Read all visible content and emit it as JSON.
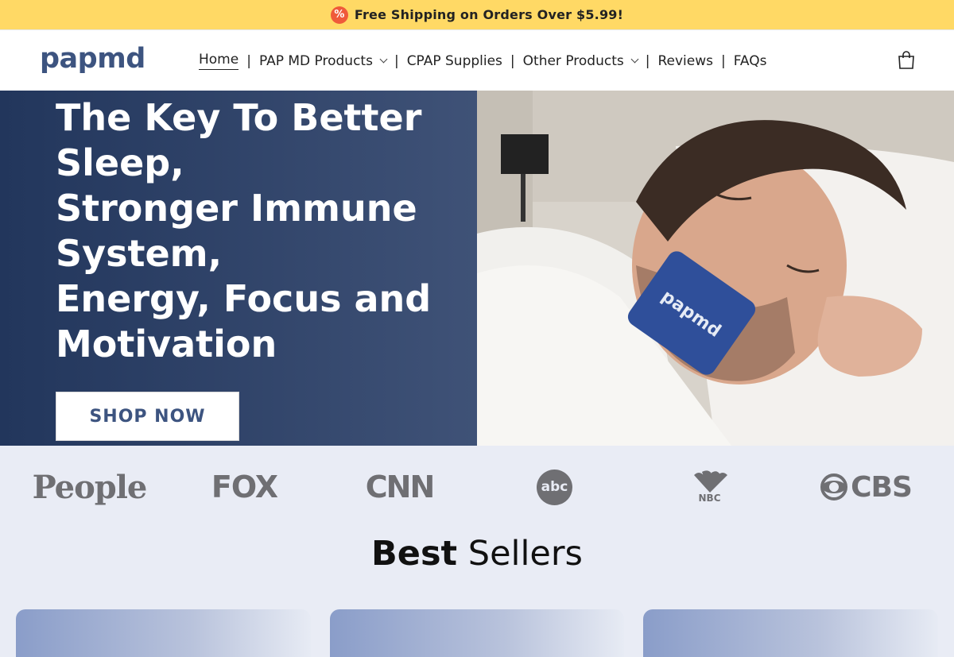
{
  "announcement": {
    "icon": "percent-badge-icon",
    "badge": "%",
    "text": "Free Shipping on Orders Over $5.99!"
  },
  "header": {
    "logo": "papmd",
    "nav": [
      {
        "label": "Home",
        "active": true,
        "dropdown": false
      },
      {
        "label": "PAP MD Products",
        "active": false,
        "dropdown": true
      },
      {
        "label": "CPAP Supplies",
        "active": false,
        "dropdown": false
      },
      {
        "label": "Other Products",
        "active": false,
        "dropdown": true
      },
      {
        "label": "Reviews",
        "active": false,
        "dropdown": false
      },
      {
        "label": "FAQs",
        "active": false,
        "dropdown": false
      }
    ],
    "separator": "|",
    "cart_icon": "shopping-bag-icon"
  },
  "hero": {
    "title_lines": [
      "The Key To Better Sleep,",
      "Stronger Immune System,",
      "energy, Focus and Motivation"
    ],
    "title_display": [
      "The Key To Better",
      "Sleep,",
      "Stronger Immune",
      "System,",
      "Energy, Focus and",
      "Motivation"
    ],
    "cta": "SHOP NOW",
    "image_label": "papmd",
    "colors": {
      "panel_start": "#22365c",
      "panel_end": "#3f5277"
    }
  },
  "press": [
    "People",
    "FOX",
    "CNN",
    "abc",
    "NBC",
    "CBS"
  ],
  "best_sellers": {
    "bold": "Best",
    "light": "Sellers"
  },
  "colors": {
    "brand": "#3d5480",
    "announce_bg": "#ffd965",
    "badge": "#ef5a3a",
    "page_bg": "#e9ecf5"
  }
}
